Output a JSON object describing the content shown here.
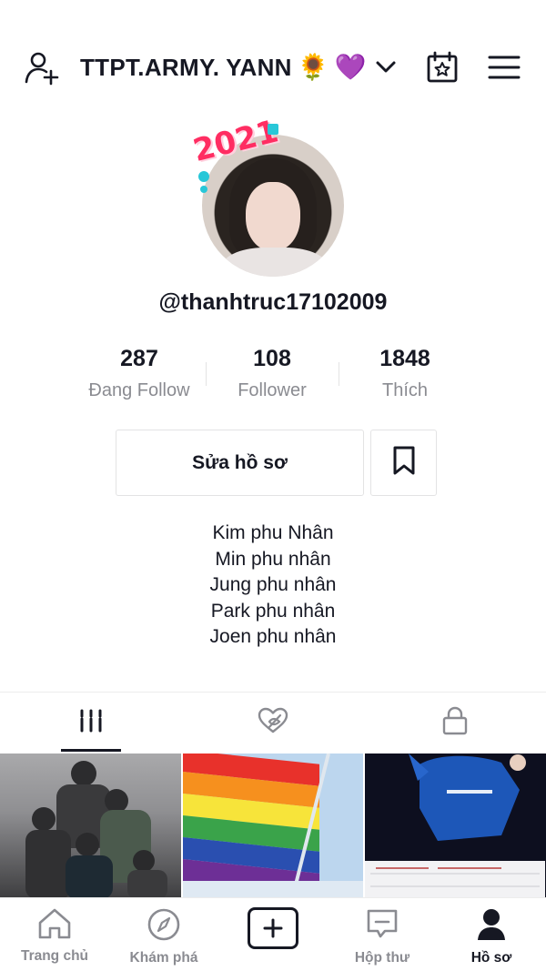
{
  "header": {
    "username": "TTPT.ARMY. YANN",
    "emojis": [
      "🌻",
      "💜"
    ],
    "icons": [
      "add-user-icon",
      "chevron-down-icon",
      "calendar-star-icon",
      "menu-icon"
    ]
  },
  "profile": {
    "avatar_badge": "2021",
    "handle": "@thanhtruc17102009"
  },
  "stats": [
    {
      "value": "287",
      "label": "Đang Follow"
    },
    {
      "value": "108",
      "label": "Follower"
    },
    {
      "value": "1848",
      "label": "Thích"
    }
  ],
  "actions": {
    "edit_profile": "Sửa hồ sơ",
    "bookmark_icon": "bookmark-icon"
  },
  "bio": [
    "Kim phu Nhân",
    "Min phu nhân",
    "Jung phu nhân",
    "Park phu nhân",
    "Joen phu nhân"
  ],
  "tabs": [
    {
      "icon": "grid-icon",
      "active": true
    },
    {
      "icon": "liked-hidden-icon",
      "active": false
    },
    {
      "icon": "lock-icon",
      "active": false
    }
  ],
  "nav": [
    {
      "label": "Trang chủ",
      "icon": "home-icon"
    },
    {
      "label": "Khám phá",
      "icon": "compass-icon"
    },
    {
      "label": "",
      "icon": "plus-icon"
    },
    {
      "label": "Hộp thư",
      "icon": "inbox-icon"
    },
    {
      "label": "Hồ sơ",
      "icon": "profile-icon",
      "active": true
    }
  ],
  "colors": {
    "text": "#161823",
    "muted": "#8a8b91",
    "border": "#e3e3e4",
    "badge": "#ff2d62"
  }
}
